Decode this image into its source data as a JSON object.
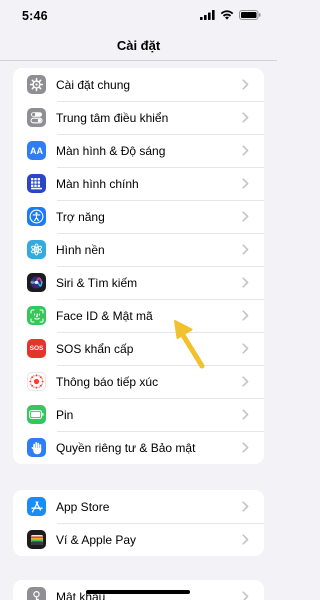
{
  "status_bar": {
    "time": "5:46"
  },
  "nav": {
    "title": "Cài đặt"
  },
  "group1": [
    {
      "label": "Cài đặt chung",
      "icon": "gear-icon",
      "color": "#8e8e93"
    },
    {
      "label": "Trung tâm điều khiển",
      "icon": "toggles-icon",
      "color": "#8e8e93"
    },
    {
      "label": "Màn hình & Độ sáng",
      "icon": "aa-text-icon",
      "color": "#2f7df6"
    },
    {
      "label": "Màn hình chính",
      "icon": "app-grid-icon",
      "color": "#2b44c8"
    },
    {
      "label": "Trợ năng",
      "icon": "accessibility-icon",
      "color": "#1a7cf5"
    },
    {
      "label": "Hình nền",
      "icon": "flower-icon",
      "color": "#35aadc"
    },
    {
      "label": "Siri & Tìm kiếm",
      "icon": "siri-icon",
      "color": "#1c1c1e"
    },
    {
      "label": "Face ID & Mật mã",
      "icon": "face-id-icon",
      "color": "#34c759"
    },
    {
      "label": "SOS khẩn cấp",
      "icon": "sos-icon",
      "color": "#e5352b",
      "icon_text": "SOS"
    },
    {
      "label": "Thông báo tiếp xúc",
      "icon": "exposure-icon",
      "color": "#ffffff"
    },
    {
      "label": "Pin",
      "icon": "battery-icon",
      "color": "#34c759"
    },
    {
      "label": "Quyền riêng tư & Bảo mật",
      "icon": "hand-icon",
      "color": "#2f7df6"
    }
  ],
  "group2": [
    {
      "label": "App Store",
      "icon": "app-store-icon",
      "color": "#1a8cf5"
    },
    {
      "label": "Ví & Apple Pay",
      "icon": "wallet-icon",
      "color": "#1c1c1e"
    }
  ],
  "group3": [
    {
      "label": "Mật khẩu",
      "icon": "key-icon",
      "color": "#8e8e93"
    }
  ],
  "colors": {
    "background": "#f2f2f7",
    "chevron": "#c4c4c7",
    "arrow": "#f2c12e"
  }
}
